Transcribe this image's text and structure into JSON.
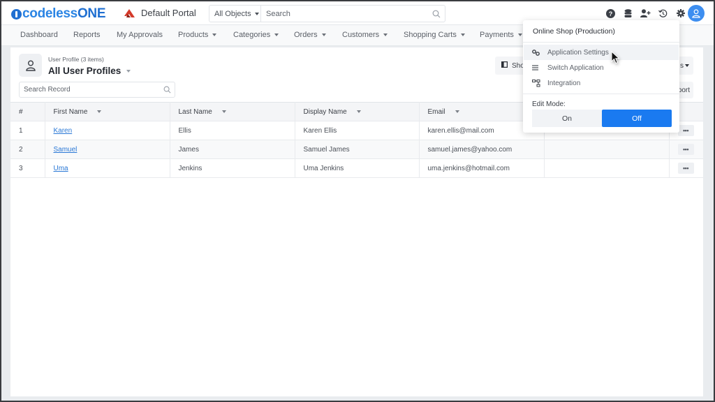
{
  "header": {
    "brand": {
      "prefix": "codeless",
      "suffix": "ONE"
    },
    "portal": "Default Portal",
    "object_selector": "All Objects",
    "search_placeholder": "Search",
    "icons": [
      "help-icon",
      "database-icon",
      "add-user-icon",
      "history-icon",
      "settings-icon",
      "user-avatar-icon"
    ]
  },
  "nav": {
    "items": [
      {
        "label": "Dashboard",
        "dropdown": false
      },
      {
        "label": "Reports",
        "dropdown": false
      },
      {
        "label": "My Approvals",
        "dropdown": false
      },
      {
        "label": "Products",
        "dropdown": true
      },
      {
        "label": "Categories",
        "dropdown": true
      },
      {
        "label": "Orders",
        "dropdown": true
      },
      {
        "label": "Customers",
        "dropdown": true
      },
      {
        "label": "Shopping Carts",
        "dropdown": true
      },
      {
        "label": "Payments",
        "dropdown": true
      }
    ]
  },
  "list": {
    "subtitle": "User Profile (3 items)",
    "title": "All User Profiles",
    "search_placeholder": "Search Record",
    "show_button": "Sho",
    "views_button": "s",
    "export_button": "port"
  },
  "table": {
    "columns": [
      "#",
      "First Name",
      "Last Name",
      "Display Name",
      "Email",
      "",
      ""
    ],
    "rows": [
      {
        "num": "1",
        "first": "Karen",
        "last": "Ellis",
        "display": "Karen Ellis",
        "email": "karen.ellis@mail.com",
        "menu": "•••"
      },
      {
        "num": "2",
        "first": "Samuel",
        "last": "James",
        "display": "Samuel James",
        "email": "samuel.james@yahoo.com",
        "menu": "•••"
      },
      {
        "num": "3",
        "first": "Uma",
        "last": "Jenkins",
        "display": "Uma Jenkins",
        "email": "uma.jenkins@hotmail.com",
        "menu": "•••"
      }
    ]
  },
  "dropdown": {
    "header": "Online Shop (Production)",
    "items": [
      {
        "label": "Application Settings",
        "icon": "gears-icon",
        "hovered": true
      },
      {
        "label": "Switch Application",
        "icon": "list-icon",
        "hovered": false
      },
      {
        "label": "Integration",
        "icon": "integration-icon",
        "hovered": false
      }
    ],
    "edit_mode_label": "Edit Mode:",
    "toggle": {
      "on": "On",
      "off": "Off",
      "selected": "Off"
    }
  },
  "colors": {
    "brand": "#1f6fd1",
    "accent": "#1a7af0",
    "link": "#2a78d6",
    "portal_icon": "#d43a2a"
  }
}
